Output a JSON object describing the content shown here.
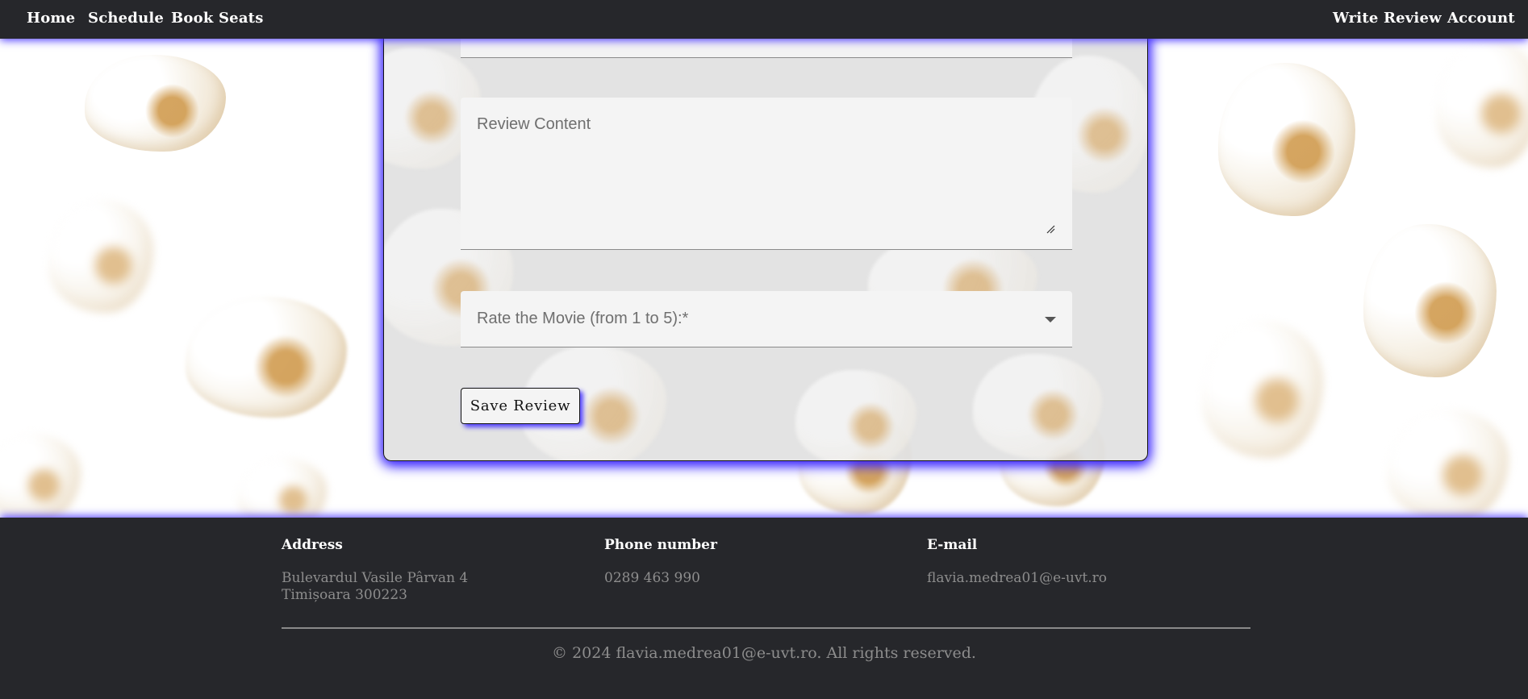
{
  "nav": {
    "home": "Home",
    "schedule": "Schedule",
    "book_seats": "Book Seats",
    "write_review": "Write Review",
    "account": "Account"
  },
  "form": {
    "content_placeholder": "Review Content",
    "rating_label": "Rate the Movie (from 1 to 5):*",
    "save_label": "Save Review"
  },
  "footer": {
    "address_heading": "Address",
    "address_line1": "Bulevardul Vasile Pârvan 4",
    "address_line2": "Timișoara 300223",
    "phone_heading": "Phone number",
    "phone_value": "0289 463 990",
    "email_heading": "E-mail",
    "email_value": "flavia.medrea01@e-uvt.ro",
    "copyright": "© 2024 flavia.medrea01@e-uvt.ro. All rights reserved."
  },
  "icons": {
    "dropdown": "chevron-down-icon",
    "resize": "resize-grip-icon"
  },
  "colors": {
    "nav_bg": "#26272b",
    "accent_glow": "#4632ff",
    "card_bg": "#e0e0e0",
    "footer_text": "#8d8d8d"
  }
}
